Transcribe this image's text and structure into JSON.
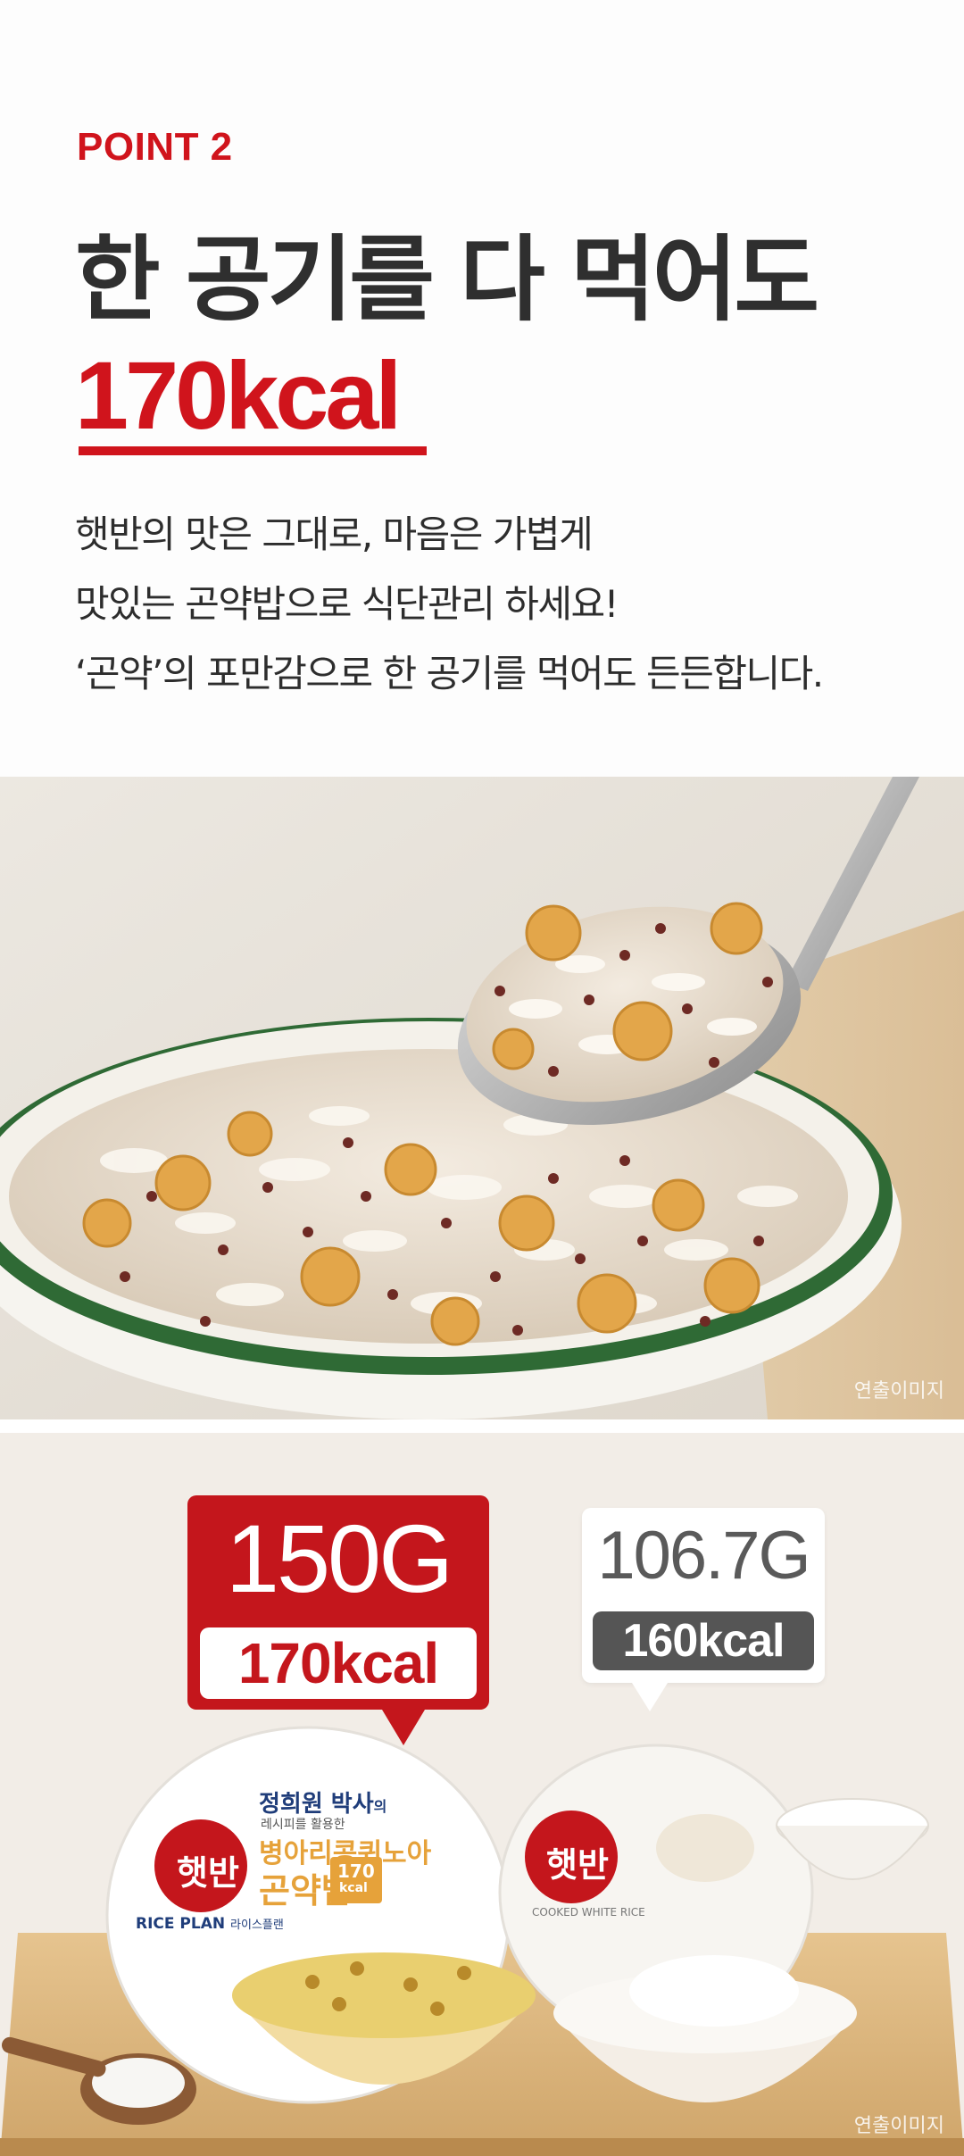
{
  "section_label": "POINT 2",
  "headline": {
    "line1": "한 공기를 다 먹어도",
    "line2": "170kcal"
  },
  "description": [
    "햇반의 맛은 그대로, 마음은 가볍게",
    "맛있는 곤약밥으로 식단관리 하세요!",
    "‘곤약’의 포만감으로 한 공기를 먹어도 든든합니다."
  ],
  "photo1": {
    "watermark": "연출이미지"
  },
  "comparison": {
    "konjac": {
      "weight": "150G",
      "kcal": "170kcal",
      "brand": "햇반",
      "author": "정희원 박사",
      "author_suffix": "의",
      "recipe_note": "레시피를 활용한",
      "product_line1": "병아리콩퀴노아",
      "product_line2": "곤약밥",
      "badge_value": "170",
      "badge_unit": "kcal",
      "series": "RICE PLAN",
      "series_kr": "라이스플랜"
    },
    "white_rice": {
      "weight": "106.7G",
      "kcal": "160kcal",
      "brand": "햇반",
      "subtitle": "COOKED WHITE RICE"
    },
    "watermark": "연출이미지"
  },
  "colors": {
    "accent_red": "#d0141c",
    "bubble_red": "#c4161c",
    "bubble_gray": "#555555",
    "headline_text": "#2f2f2f"
  }
}
